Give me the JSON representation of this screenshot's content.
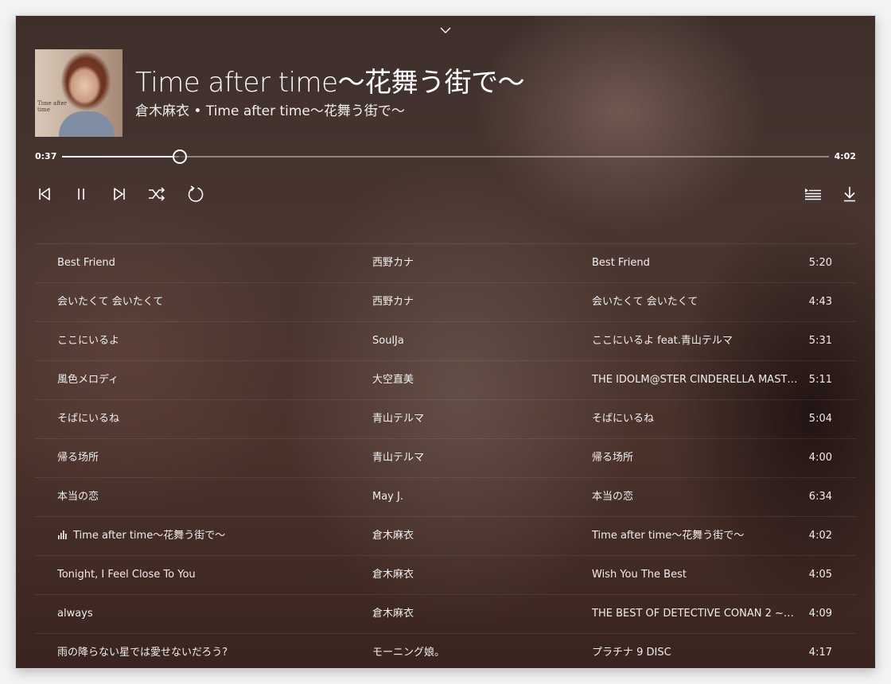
{
  "now_playing": {
    "title": "Time after time〜花舞う街で〜",
    "subtitle": "倉木麻衣 • Time after time〜花舞う街で〜",
    "cover_text": "Time after time",
    "current_time": "0:37",
    "total_time": "4:02",
    "progress_fraction": 0.153
  },
  "icons": {
    "collapse": "chevron-down-icon",
    "previous": "skip-previous-icon",
    "pause": "pause-icon",
    "next": "skip-next-icon",
    "shuffle": "shuffle-icon",
    "repeat": "repeat-icon",
    "queue": "queue-list-icon",
    "download": "download-icon",
    "playing": "equalizer-icon"
  },
  "colors": {
    "text": "#ffffff",
    "track": "rgba(255,255,255,0.4)"
  },
  "playlist": [
    {
      "title": "Best Friend",
      "artist": "西野カナ",
      "album": "Best Friend",
      "duration": "5:20",
      "playing": false
    },
    {
      "title": "会いたくて 会いたくて",
      "artist": "西野カナ",
      "album": "会いたくて 会いたくて",
      "duration": "4:43",
      "playing": false
    },
    {
      "title": "ここにいるよ",
      "artist": "SoulJa",
      "album": "ここにいるよ feat.青山テルマ",
      "duration": "5:31",
      "playing": false
    },
    {
      "title": "風色メロディ",
      "artist": "大空直美",
      "album": "THE IDOLM@STER CINDERELLA MASTER...",
      "duration": "5:11",
      "playing": false
    },
    {
      "title": "そばにいるね",
      "artist": "青山テルマ",
      "album": "そばにいるね",
      "duration": "5:04",
      "playing": false
    },
    {
      "title": "帰る场所",
      "artist": "青山テルマ",
      "album": "帰る场所",
      "duration": "4:00",
      "playing": false
    },
    {
      "title": "本当の恋",
      "artist": "May J.",
      "album": "本当の恋",
      "duration": "6:34",
      "playing": false
    },
    {
      "title": "Time after time〜花舞う街で〜",
      "artist": "倉木麻衣",
      "album": "Time after time〜花舞う街で〜",
      "duration": "4:02",
      "playing": true
    },
    {
      "title": "Tonight, I Feel Close To You",
      "artist": "倉木麻衣",
      "album": "Wish You The Best",
      "duration": "4:05",
      "playing": false
    },
    {
      "title": "always",
      "artist": "倉木麻衣",
      "album": "THE BEST OF DETECTIVE CONAN 2 ~名探...",
      "duration": "4:09",
      "playing": false
    },
    {
      "title": "雨の降らない星では愛せないだろう?",
      "artist": "モーニング娘。",
      "album": "プラチナ 9 DISC",
      "duration": "4:17",
      "playing": false
    }
  ]
}
